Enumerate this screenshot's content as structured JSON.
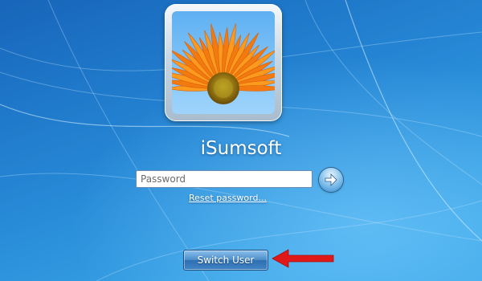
{
  "colors": {
    "background_top": "#1a6fc4",
    "background_bottom": "#2e9ae0",
    "text": "#ffffff",
    "annotation_arrow": "#e01818"
  },
  "user": {
    "name": "iSumsoft",
    "avatar_icon": "orange-gerbera-flower-avatar"
  },
  "login": {
    "password_placeholder": "Password",
    "password_value": "",
    "submit_icon": "arrow-right-icon",
    "reset_link": "Reset password..."
  },
  "footer": {
    "switch_user_label": "Switch User"
  },
  "annotation": {
    "icon": "red-arrow-icon"
  }
}
